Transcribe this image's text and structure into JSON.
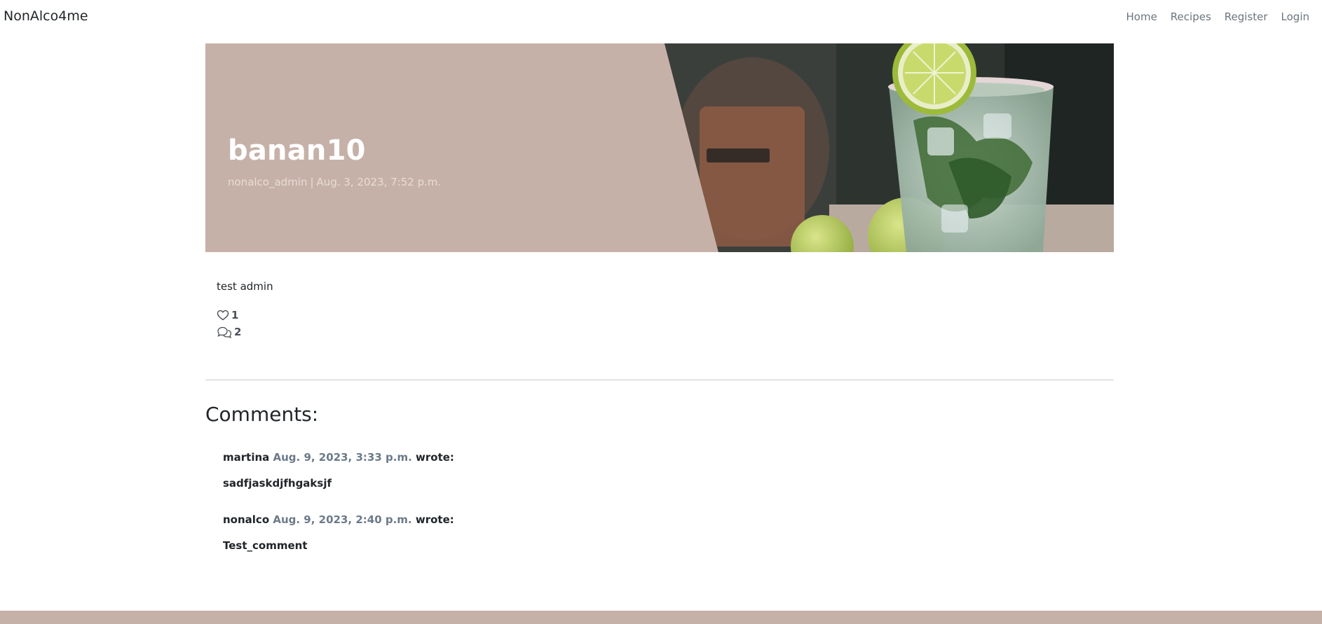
{
  "navbar": {
    "brand": "NonAlco4me",
    "links": [
      "Home",
      "Recipes",
      "Register",
      "Login"
    ]
  },
  "hero": {
    "title": "banan10",
    "author": "nonalco_admin",
    "separator": "|",
    "date": "Aug. 3, 2023, 7:52 p.m.",
    "image": "mojito-cocktail-photo"
  },
  "post": {
    "body": "test admin",
    "likes": "1",
    "comments_count": "2",
    "like_icon": "heart-icon",
    "comment_icon": "chat-bubbles-icon"
  },
  "comments": {
    "title": "Comments:",
    "items": [
      {
        "author": "martina",
        "date": "Aug. 9, 2023, 3:33 p.m.",
        "wrote": "wrote:",
        "body": "sadfjaskdjfhgaksjf"
      },
      {
        "author": "nonalco",
        "date": "Aug. 9, 2023, 2:40 p.m.",
        "wrote": "wrote:",
        "body": "Test_comment"
      }
    ]
  },
  "colors": {
    "accent": "#c6b1a8",
    "muted_text": "#6c757d",
    "date_text": "#6c7a8a"
  }
}
